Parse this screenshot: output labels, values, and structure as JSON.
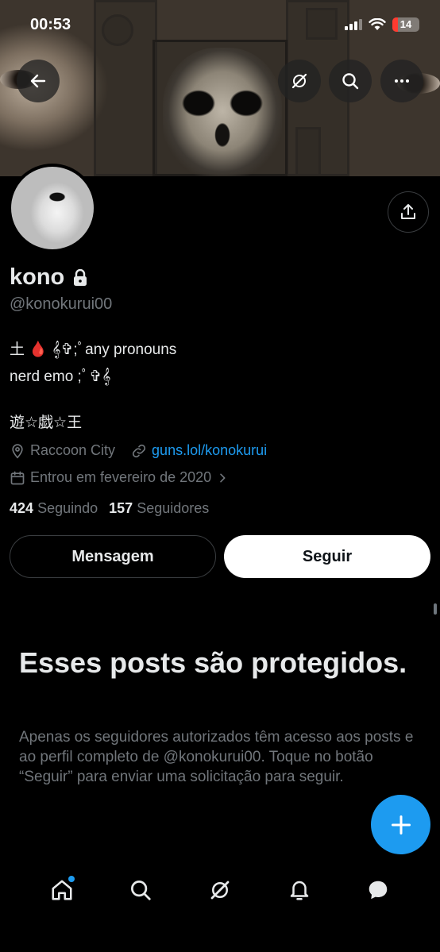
{
  "status_bar": {
    "time": "00:53",
    "battery": "14"
  },
  "profile": {
    "name": "kono",
    "handle": "@konokurui00",
    "bio_lines": "土 🩸 𝄞✞;ﾟany pronouns\nnerd emo ;ﾟ✞𝄞",
    "bio_extra": "遊☆戯☆王",
    "location": "Raccoon City",
    "website": "guns.lol/konokurui",
    "joined": "Entrou em fevereiro de 2020",
    "following_count": "424",
    "following_label": "Seguindo",
    "followers_count": "157",
    "followers_label": "Seguidores"
  },
  "buttons": {
    "message": "Mensagem",
    "follow": "Seguir"
  },
  "protected": {
    "title": "Esses posts são protegidos.",
    "description": "Apenas os seguidores autorizados têm acesso aos posts e ao perfil completo de @konokurui00. Toque no botão “Seguir” para enviar uma solicitação para seguir."
  },
  "icons": {
    "back": "arrow-left-icon",
    "grok": "grok-icon",
    "search": "search-icon",
    "more": "more-icon",
    "share": "share-icon",
    "lock": "lock-icon",
    "location": "location-pin-icon",
    "link": "link-icon",
    "calendar": "calendar-icon",
    "compose": "plus-icon"
  },
  "nav": [
    "home",
    "search",
    "grok",
    "notifications",
    "messages"
  ],
  "colors": {
    "accent": "#1d9bf0",
    "background": "#000000",
    "muted": "#71767b",
    "text": "#e7e9ea"
  }
}
